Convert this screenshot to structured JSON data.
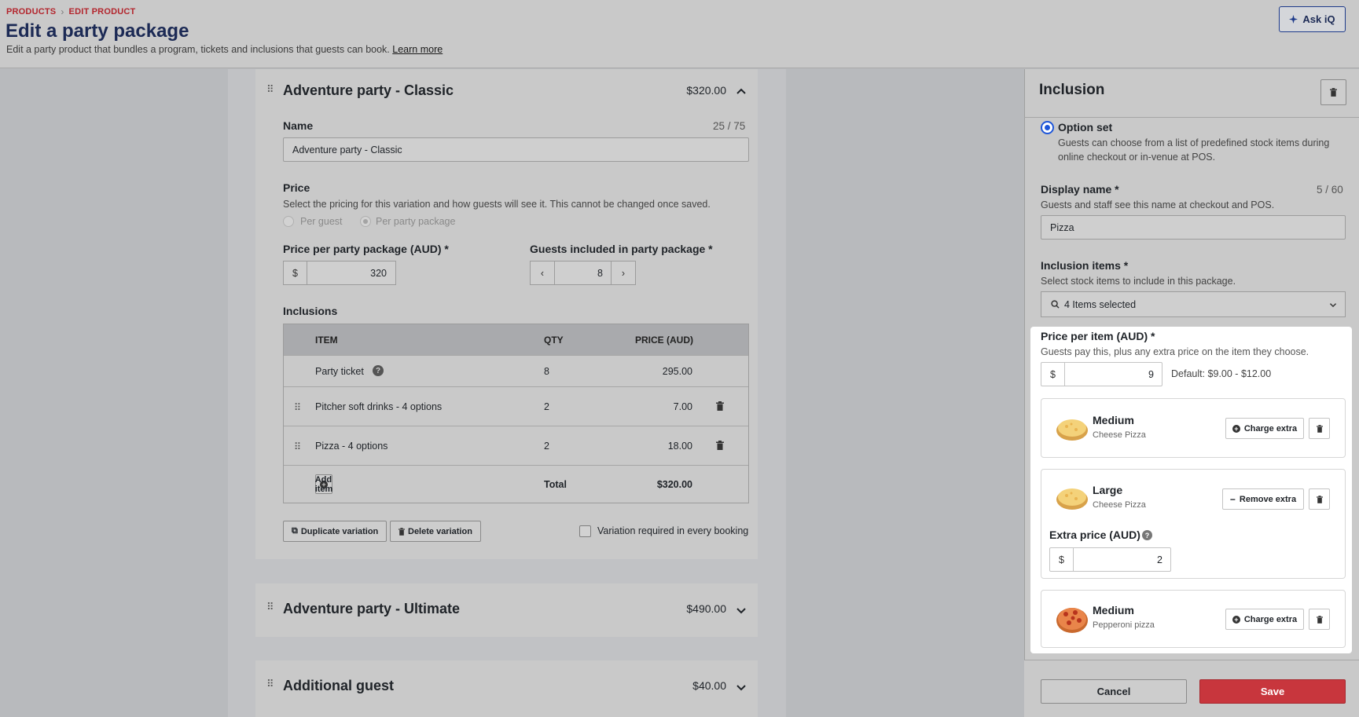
{
  "header": {
    "breadcrumb": [
      "PRODUCTS",
      "EDIT PRODUCT"
    ],
    "title": "Edit a party package",
    "subtitle": "Edit a party product that bundles a program, tickets and inclusions that guests can book.",
    "learn_more": "Learn more",
    "ask_label": "Ask iQ"
  },
  "variation_classic": {
    "title": "Adventure party - Classic",
    "price": "$320.00",
    "name_label": "Name",
    "name_counter": "25 / 75",
    "name_value": "Adventure party - Classic",
    "price_label": "Price",
    "price_desc": "Select the pricing for this variation and how guests will see it. This cannot be changed once saved.",
    "per_guest": "Per guest",
    "per_party": "Per party package",
    "price_per_party_label": "Price per party package (AUD) *",
    "currency": "$",
    "price_value": "320",
    "guests_label": "Guests included in party package *",
    "guests_value": "8",
    "inclusions_label": "Inclusions",
    "table": {
      "headers": [
        "ITEM",
        "QTY",
        "PRICE (AUD)"
      ],
      "rows": [
        {
          "item": "Party ticket",
          "qty": "8",
          "price": "295.00"
        },
        {
          "item": "Pitcher soft drinks - 4 options",
          "qty": "2",
          "price": "7.00"
        },
        {
          "item": "Pizza - 4 options",
          "qty": "2",
          "price": "18.00"
        }
      ],
      "add_item": "Add item",
      "total_label": "Total",
      "total_value": "$320.00"
    },
    "duplicate": "Duplicate variation",
    "delete": "Delete variation",
    "required_label": "Variation required in every booking"
  },
  "variation_ultimate": {
    "title": "Adventure party - Ultimate",
    "price": "$490.00"
  },
  "variation_additional": {
    "title": "Additional guest",
    "price": "$40.00"
  },
  "panel": {
    "title": "Inclusion",
    "option_set_label": "Option set",
    "option_set_desc_1": "Guests can choose from a list of predefined stock items during",
    "option_set_desc_2": "online checkout or in-venue at POS.",
    "display_name_label": "Display name *",
    "display_name_counter": "5 / 60",
    "display_name_desc": "Guests and staff see this name at checkout and POS.",
    "display_name_value": "Pizza",
    "inclusion_items_label": "Inclusion items *",
    "inclusion_items_desc": "Select stock items to include in this package.",
    "items_selected": "4 Items selected",
    "price_per_item_label": "Price per item (AUD) *",
    "price_per_item_desc": "Guests pay this, plus any extra price on the item they choose.",
    "currency": "$",
    "price_per_item_value": "9",
    "default_text": "Default: $9.00 - $12.00",
    "items": [
      {
        "name": "Medium",
        "variant": "Cheese Pizza",
        "action": "Charge extra"
      },
      {
        "name": "Large",
        "variant": "Cheese Pizza",
        "action": "Remove extra",
        "extra_label": "Extra price (AUD)",
        "extra_value": "2"
      },
      {
        "name": "Medium",
        "variant": "Pepperoni pizza",
        "action": "Charge extra"
      }
    ],
    "cancel": "Cancel",
    "save": "Save"
  },
  "colors": {
    "accent": "#1e56d9",
    "brand_red": "#c8363d",
    "title_navy": "#1c2a55"
  }
}
